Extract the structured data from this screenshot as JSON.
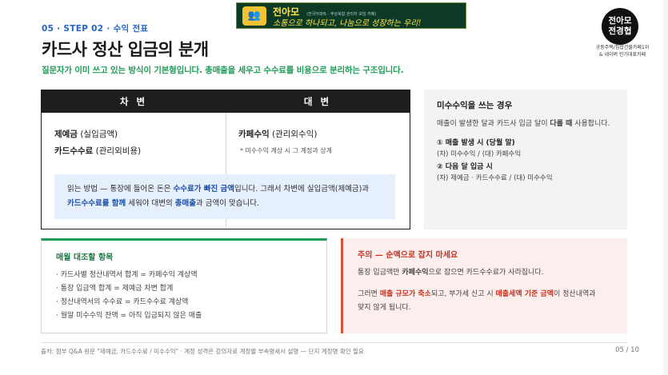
{
  "header": {
    "step": "05 · STEP 02 · 수익 전표",
    "title": "카드사 정산 입금의 분개",
    "subtitle": "질문자가 이미 쓰고 있는 방식이 기본형입니다. 총매출을 세우고 수수료를 비용으로 분리하는 구조입니다."
  },
  "banner": {
    "name": "전아모",
    "small": "(전국아파트 · 주상복합 관리자 모임 카페)",
    "slogan": "소통으로 하나되고, 나눔으로 성장하는 우리!"
  },
  "logo": {
    "line1": "전아모",
    "line2": "전경협",
    "caption1": "공동주택/집합건물카페1위",
    "caption2": "& 네이버 인기대표카페"
  },
  "ledger": {
    "debit_head": "차 변",
    "credit_head": "대 변",
    "debit1_bold": "제예금",
    "debit1_rest": " (실입금액)",
    "debit2_bold": "카드수수료",
    "debit2_rest": " (관리외비용)",
    "credit1_bold": "카페수익",
    "credit1_rest": " (관리외수익)",
    "credit_note": "* 미수수익 계상 시 그 계정과 상계",
    "explain_p1": "읽는 방법 — 통장에 들어온 돈은 ",
    "explain_b1": "수수료가 빠진 금액",
    "explain_p2": "입니다. 그래서 차변에 실입금액(제예금)과",
    "explain_b2": "카드수수료를 함께",
    "explain_p3": " 세워야 대변의 ",
    "explain_b3": "총매출",
    "explain_p4": "과 금액이 맞습니다."
  },
  "side": {
    "title": "미수수익을 쓰는 경우",
    "desc_p1": "매출이 발생한 달과 카드사 입금 달이 ",
    "desc_b": "다를 때",
    "desc_p2": " 사용합니다.",
    "step1": "① 매출 발생 시 (당월 말)",
    "entry1": "(차) 미수수익 / (대) 카페수익",
    "step2": "② 다음 달 입금 시",
    "entry2": "(차) 제예금 · 카드수수료 / (대) 미수수익"
  },
  "checklist": {
    "title": "매월 대조할 항목",
    "items": [
      "· 카드사별 정산내역서 합계 = 카페수익 계상액",
      "· 통장 입금액 합계 = 제예금 차변 합계",
      "· 정산내역서의 수수료 = 카드수수료 계상액",
      "· 월말 미수수익 잔액 = 아직 입금되지 않은 매출"
    ]
  },
  "warning": {
    "title": "주의 — 순액으로 잡지 마세요",
    "l1_p1": "통장 입금액만 ",
    "l1_b": "카페수익",
    "l1_p2": "으로 잡으면 카드수수료가 사라집니다.",
    "l2_p1": "그러면 ",
    "l2_b1": "매출 규모가 축소",
    "l2_p2": "되고, 부가세 신고 시 ",
    "l2_b2": "매출세액 기준 금액",
    "l2_p3": "이 정산내역과",
    "l3": "맞지 않게 됩니다."
  },
  "footer": {
    "source": "출처: 첨부 Q&A 원문 \"제예금, 카드수수료 / 미수수익\" · 계정 성격은 강의자료 계정별 부속명세서 설명 — 단지 계정명 확인 필요",
    "page": "05 / 10"
  },
  "colors": {
    "accent_blue": "#2463c9",
    "accent_green": "#1f9d58",
    "warning_red": "#c8321e"
  }
}
